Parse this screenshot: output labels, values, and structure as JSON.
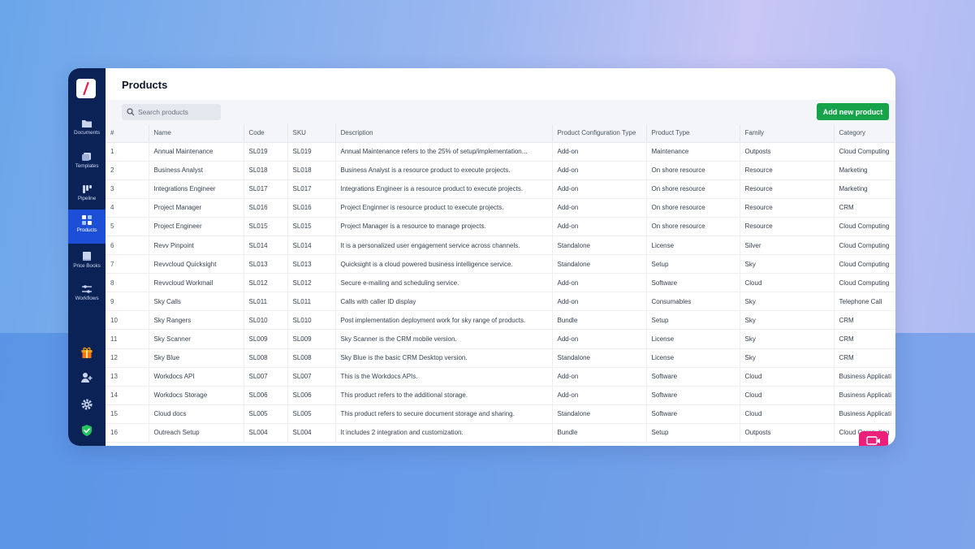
{
  "app": {
    "title": "Products",
    "brand_color": "#0b2257",
    "accent_color": "#1d4ed8",
    "logo_icon": "slash-logo-icon"
  },
  "sidebar": {
    "items": [
      {
        "label": "Documents",
        "icon": "folder-icon"
      },
      {
        "label": "Templates",
        "icon": "templates-icon"
      },
      {
        "label": "Pipeline",
        "icon": "pipeline-icon"
      },
      {
        "label": "Products",
        "icon": "products-grid-icon",
        "active": true
      },
      {
        "label": "Price Books",
        "icon": "price-book-icon"
      },
      {
        "label": "Workflows",
        "icon": "workflow-sliders-icon"
      }
    ],
    "bottom_icons": [
      "gift-icon",
      "add-user-icon",
      "settings-gear-icon",
      "shield-check-icon"
    ]
  },
  "toolbar": {
    "search_placeholder": "Search products",
    "add_label": "Add new product",
    "add_color": "#16a34a"
  },
  "table": {
    "columns": [
      "#",
      "Name",
      "Code",
      "SKU",
      "Description",
      "Product Configuration Type",
      "Product Type",
      "Family",
      "Category"
    ],
    "rows": [
      [
        "1",
        "Annual Maintenance",
        "SL019",
        "SL019",
        "Annual Maintenance refers to the 25% of setup/implementation...",
        "Add-on",
        "Maintenance",
        "Outposts",
        "Cloud Computing"
      ],
      [
        "2",
        "Business Analyst",
        "SL018",
        "SL018",
        "Business Analyst is a resource product to execute projects.",
        "Add-on",
        "On shore resource",
        "Resource",
        "Marketing"
      ],
      [
        "3",
        "Integrations Engineer",
        "SL017",
        "SL017",
        "Integrations Engineer is a resource product to execute projects.",
        "Add-on",
        "On shore resource",
        "Resource",
        "Marketing"
      ],
      [
        "4",
        "Project Manager",
        "SL016",
        "SL016",
        "Project Enginner is resource product to execute projects.",
        "Add-on",
        "On shore resource",
        "Resource",
        "CRM"
      ],
      [
        "5",
        "Project Engineer",
        "SL015",
        "SL015",
        "Project Manager is a resource to manage projects.",
        "Add-on",
        "On shore resource",
        "Resource",
        "Cloud Computing"
      ],
      [
        "6",
        "Revv Pinpoint",
        "SL014",
        "SL014",
        "It is a personalized user engagement service across channels.",
        "Standalone",
        "License",
        "Silver",
        "Cloud Computing"
      ],
      [
        "7",
        "Revvcloud Quicksight",
        "SL013",
        "SL013",
        "Quicksight is a cloud powered business intelligence service.",
        "Standalone",
        "Setup",
        "Sky",
        "Cloud Computing"
      ],
      [
        "8",
        "Revvcloud Workmail",
        "SL012",
        "SL012",
        "Secure e-mailing and scheduling service.",
        "Add-on",
        "Software",
        "Cloud",
        "Cloud Computing"
      ],
      [
        "9",
        "Sky Calls",
        "SL011",
        "SL011",
        "Calls with caller ID display",
        "Add-on",
        "Consumables",
        "Sky",
        "Telephone Call"
      ],
      [
        "10",
        "Sky Rangers",
        "SL010",
        "SL010",
        "Post implementation deployment work for sky range of products.",
        "Bundle",
        "Setup",
        "Sky",
        "CRM"
      ],
      [
        "11",
        "Sky Scanner",
        "SL009",
        "SL009",
        "Sky Scanner is the CRM mobile version.",
        "Add-on",
        "License",
        "Sky",
        "CRM"
      ],
      [
        "12",
        "Sky Blue",
        "SL008",
        "SL008",
        "Sky Blue is the basic CRM Desktop version.",
        "Standalone",
        "License",
        "Sky",
        "CRM"
      ],
      [
        "13",
        "Workdocs API",
        "SL007",
        "SL007",
        "This is the Workdocs APIs.",
        "Add-on",
        "Software",
        "Cloud",
        "Business Applicati"
      ],
      [
        "14",
        "Workdocs Storage",
        "SL006",
        "SL006",
        "This product refers to the additional storage.",
        "Add-on",
        "Software",
        "Cloud",
        "Business Applicati"
      ],
      [
        "15",
        "Cloud docs",
        "SL005",
        "SL005",
        "This product refers to secure document storage and sharing.",
        "Standalone",
        "Software",
        "Cloud",
        "Business Applicati"
      ],
      [
        "16",
        "Outreach Setup",
        "SL004",
        "SL004",
        "It includes 2 integration and customization.",
        "Bundle",
        "Setup",
        "Outposts",
        "Cloud Computing"
      ]
    ]
  },
  "chat_widget": {
    "icon": "chat-icon",
    "color": "#ec1f7a"
  }
}
